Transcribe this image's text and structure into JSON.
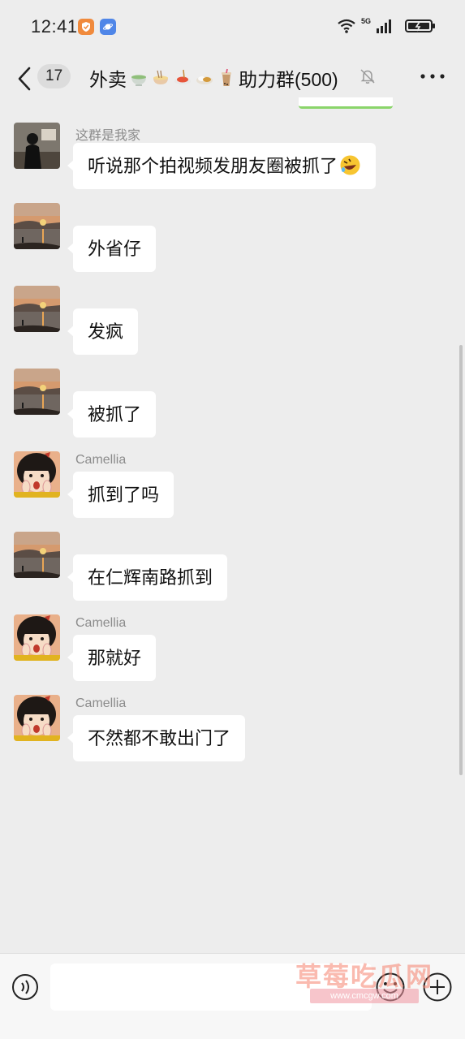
{
  "status_bar": {
    "time": "12:41",
    "network": "5G"
  },
  "nav": {
    "unread_count": "17",
    "title_prefix": "外卖",
    "title_suffix": "助力群(500)"
  },
  "messages": [
    {
      "sender": "这群是我家",
      "text": "听说那个拍视频发朋友圈被抓了",
      "avatar": "dark-photo-avatar",
      "emoji": "rolling-laughing-emoji"
    },
    {
      "sender": "",
      "text": "外省仔",
      "avatar": "sunset-lake-avatar"
    },
    {
      "sender": "",
      "text": "发疯",
      "avatar": "sunset-lake-avatar"
    },
    {
      "sender": "",
      "text": "被抓了",
      "avatar": "sunset-lake-avatar"
    },
    {
      "sender": "Camellia",
      "text": "抓到了吗",
      "avatar": "cartoon-girl-avatar"
    },
    {
      "sender": "",
      "text": "在仁辉南路抓到",
      "avatar": "sunset-lake-avatar"
    },
    {
      "sender": "Camellia",
      "text": "那就好",
      "avatar": "cartoon-girl-avatar"
    },
    {
      "sender": "Camellia",
      "text": "不然都不敢出门了",
      "avatar": "cartoon-girl-avatar"
    }
  ],
  "watermark": {
    "text": "草莓吃瓜网",
    "url": "www.cmcgw.com"
  },
  "colors": {
    "background": "#ededed",
    "bubble": "#ffffff",
    "sender": "#8c8c8c"
  }
}
